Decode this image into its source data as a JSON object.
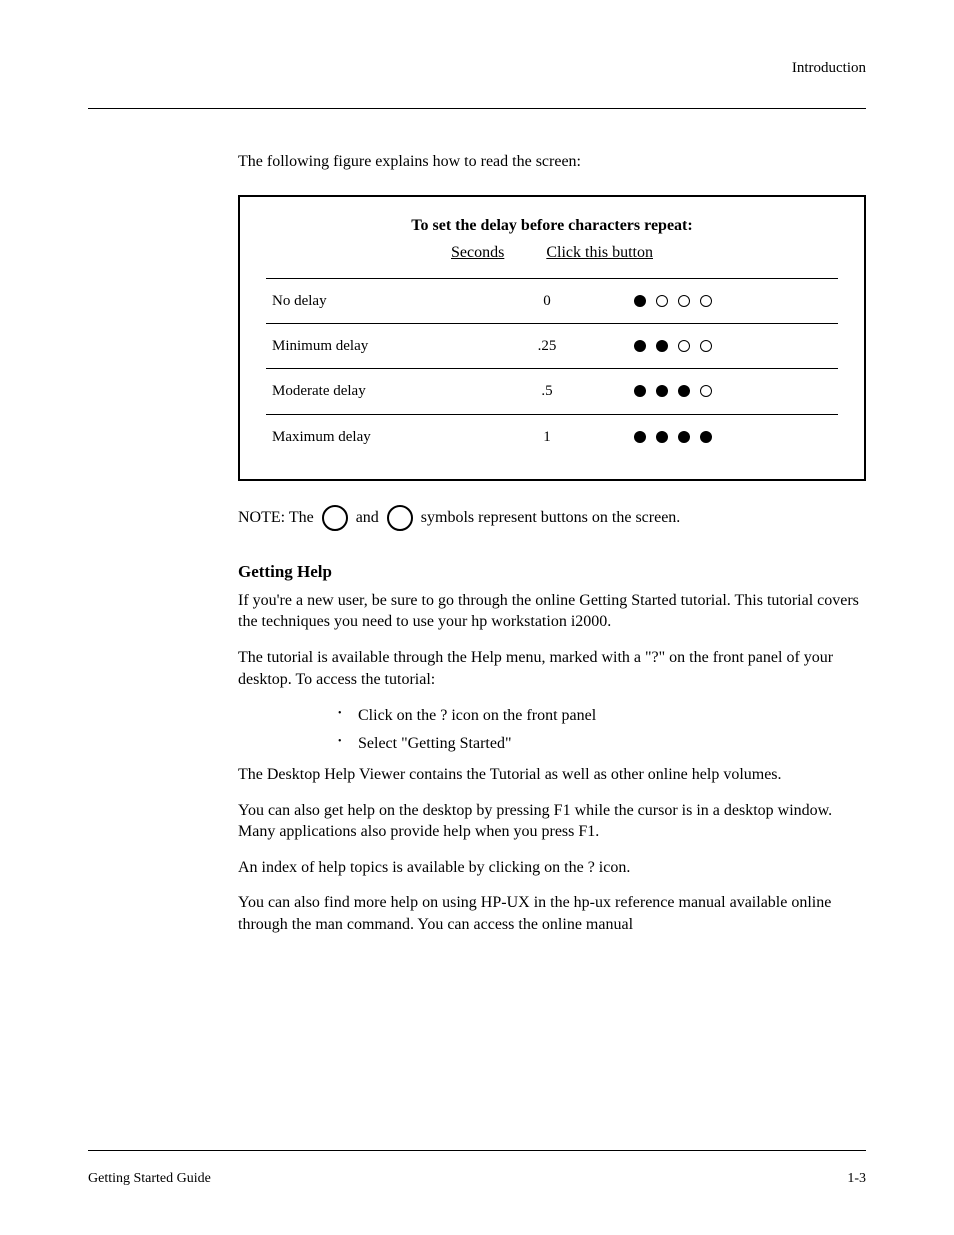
{
  "header": {
    "right": "Introduction"
  },
  "intro_para": "The following figure explains how to read the screen:",
  "figure": {
    "title": "To set the delay before characters repeat:",
    "col1": "Seconds",
    "col2": "Click this button",
    "rows": [
      {
        "label": "No delay",
        "secs": "0",
        "filled": 1
      },
      {
        "label": "Minimum delay",
        "secs": ".25",
        "filled": 2
      },
      {
        "label": "Moderate delay",
        "secs": ".5",
        "filled": 3
      },
      {
        "label": "Maximum delay",
        "secs": "1",
        "filled": 4
      }
    ]
  },
  "note": {
    "prefix": "NOTE: The",
    "mid": "and",
    "suffix": "symbols represent buttons on the screen."
  },
  "section": {
    "heading": "Getting Help",
    "p1": "If you're a new user, be sure to go through the online Getting Started tutorial. This tutorial covers the techniques you need to use your hp workstation i2000.",
    "p2": "The tutorial is available through the Help menu, marked with a \"?\" on the front panel of your desktop. To access the tutorial:",
    "bullets": [
      "Click on the ? icon on the front panel",
      "Select \"Getting Started\""
    ],
    "p3": "The Desktop Help Viewer contains the Tutorial as well as other online help volumes.",
    "p4": "You can also get help on the desktop by pressing F1 while the cursor is in a desktop window. Many applications also provide help when you press F1.",
    "p5": "An index of help topics is available by clicking on the ? icon.",
    "p6": "You can also find more help on using HP-UX in the hp-ux reference manual available online through the man command. You can access the online manual"
  },
  "footer": {
    "left": "Getting Started Guide",
    "right": "1-3"
  }
}
